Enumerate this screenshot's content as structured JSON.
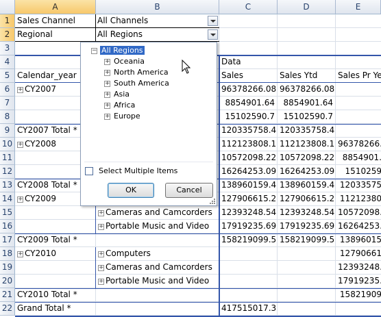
{
  "columns": [
    "A",
    "B",
    "C",
    "D",
    "E"
  ],
  "rows": [
    "1",
    "2",
    "3",
    "4",
    "5",
    "6",
    "7",
    "8",
    "9",
    "10",
    "11",
    "12",
    "13",
    "14",
    "15",
    "16",
    "17",
    "18",
    "19",
    "20",
    "21",
    "22"
  ],
  "filters": {
    "sales_channel_label": "Sales Channel",
    "sales_channel_value": "All Channels",
    "regional_label": "Regional",
    "regional_value": "All Regions"
  },
  "pivot": {
    "data_header": "Data",
    "row_field": "Calendar_year",
    "col_sales": "Sales",
    "col_sales_ytd": "Sales Ytd",
    "col_sales_pr": "Sales Pr Ye"
  },
  "cells": {
    "cy2007": "CY2007",
    "c6": "96378266.08",
    "d6": "96378266.08",
    "c7": "8854901.64",
    "d7": "8854901.64",
    "c8": "15102590.7",
    "d8": "15102590.7",
    "cy2007_total": "CY2007 Total *",
    "c9": "120335758.4",
    "d9": "120335758.4",
    "cy2008": "CY2008",
    "c10": "112123808.1",
    "d10": "112123808.1",
    "e10": "96378266.",
    "c11": "10572098.22",
    "d11": "10572098.22",
    "e11": "8854901.",
    "c12": "16264253.09",
    "d12": "16264253.09",
    "e12": "1510259",
    "cy2008_total": "CY2008 Total *",
    "c13": "138960159.4",
    "d13": "138960159.4",
    "e13": "12033575",
    "cy2009": "CY2009",
    "c14": "127906615.2",
    "d14": "127906615.2",
    "e14": "11212380",
    "b15": "Cameras and Camcorders",
    "c15": "12393248.54",
    "d15": "12393248.54",
    "e15": "10572098.",
    "b16": "Portable Music and Video",
    "c16": "17919235.69",
    "d16": "17919235.69",
    "e16": "16264253.",
    "cy2009_total": "CY2009 Total *",
    "c17": "158219099.5",
    "d17": "158219099.5",
    "e17": "13896015",
    "cy2010": "CY2010",
    "b18": "Computers",
    "e18": "12790661",
    "b19": "Cameras and Camcorders",
    "e19": "12393248.",
    "b20": "Portable Music and Video",
    "e20": "17919235.",
    "cy2010_total": "CY2010 Total *",
    "e21": "15821909",
    "grand_total": "Grand Total *",
    "c22": "417515017.3"
  },
  "popup": {
    "root": "All Regions",
    "items": [
      "Oceania",
      "North America",
      "South America",
      "Asia",
      "Africa",
      "Europe"
    ],
    "select_multiple_label": "Select Multiple Items",
    "select_multiple_checked": false,
    "ok_label": "OK",
    "cancel_label": "Cancel"
  },
  "colors": {
    "accent": "#3355aa",
    "selection": "#3169c6",
    "header_selected": "#f7c86b"
  }
}
